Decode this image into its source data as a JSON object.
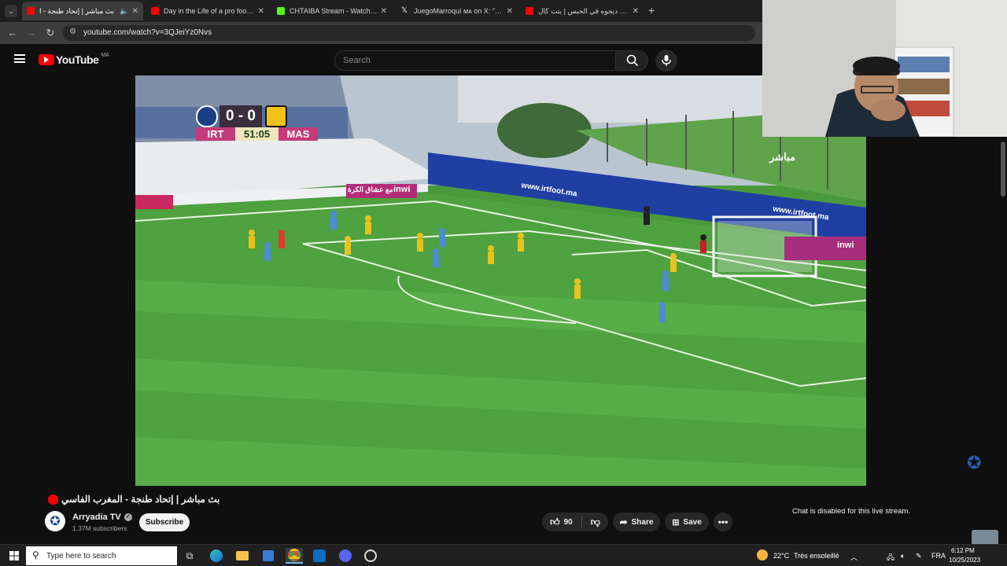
{
  "browser": {
    "tabs": [
      {
        "title": "بث مباشر | إتحاد طنجة - ا",
        "favicon_color": "#ff0000",
        "active": true
      },
      {
        "title": "Day in the Life of a pro football",
        "favicon_color": "#ff0000",
        "active": false
      },
      {
        "title": "CHTAIBA Stream - Watch Live o",
        "favicon_color": "#53fc18",
        "active": false
      },
      {
        "title": "JuegoMarroquí ᴍᴀ on X: \"Azzed",
        "favicon_color": "#ffffff",
        "active": false
      },
      {
        "title": "ديدي ديجوه في الحبس | يتت كال",
        "favicon_color": "#ff0000",
        "active": false
      }
    ],
    "new_tab_symbol": "+",
    "url": "youtube.com/watch?v=3QJeiYz0Nvs"
  },
  "youtube": {
    "logo_text": "YouTube",
    "region": "MA",
    "search_placeholder": "Search"
  },
  "video": {
    "scoreboard": {
      "home": "IRT",
      "away": "MAS",
      "score": "0 - 0",
      "clock": "51:05"
    },
    "live_badge": "مباشر",
    "ad_boards": [
      "www.irtfoot.ma",
      "www.irtfoot.ma",
      "inwi",
      "inwi",
      "مع عشاق الكرة"
    ]
  },
  "below": {
    "title": "بث مباشر | إتحاد طنجة - المغرب الفاسي",
    "channel": "Arryadia TV",
    "subscribers": "1.37M subscribers",
    "subscribe_label": "Subscribe",
    "likes": "90",
    "share_label": "Share",
    "save_label": "Save",
    "chat_notice": "Chat is disabled for this live stream."
  },
  "taskbar": {
    "search_placeholder": "Type here to search",
    "weather_temp": "22°C",
    "weather_desc": "Très ensoleillé",
    "language": "FRA",
    "time": "6:12 PM",
    "date": "10/25/2023"
  },
  "colors": {
    "accent_red": "#ff0000",
    "yt_bg": "#0f0f0f",
    "pitch_green": "#4a9a3c"
  }
}
